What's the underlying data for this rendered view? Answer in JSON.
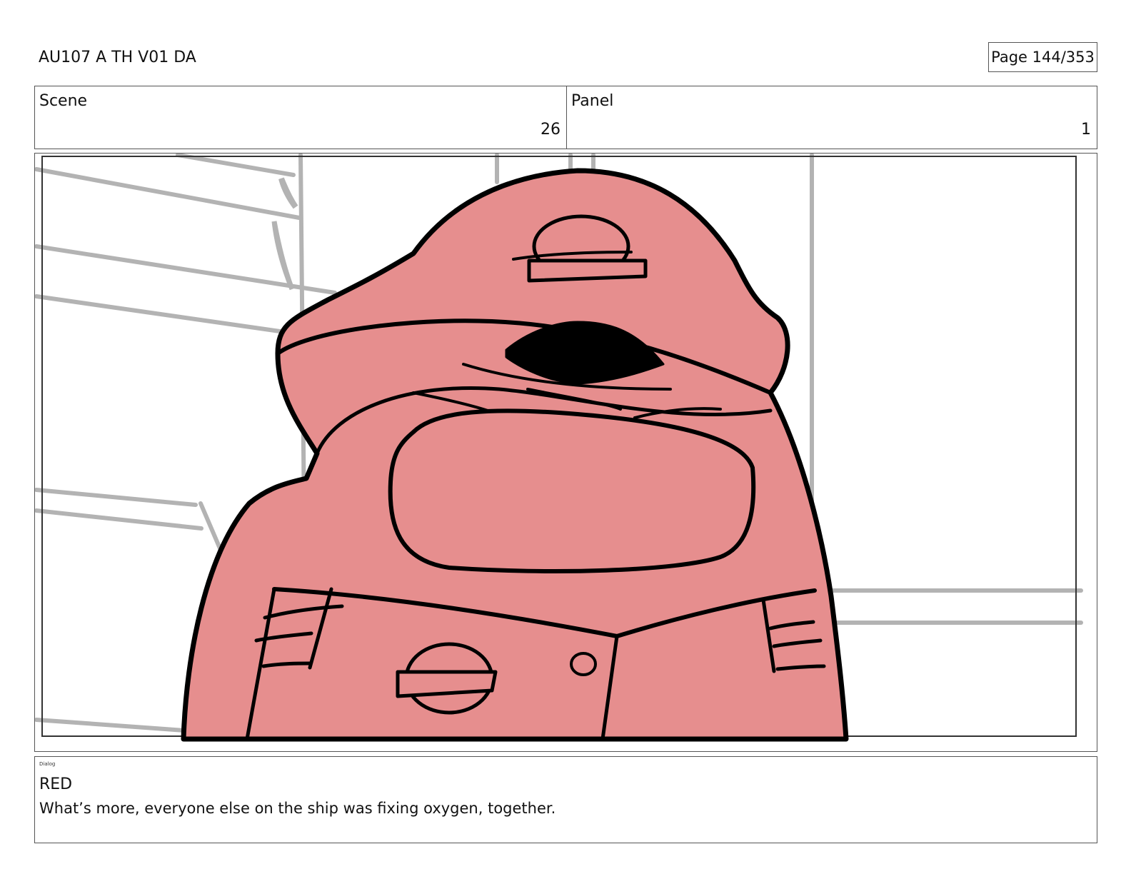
{
  "header": {
    "title": "AU107 A TH V01 DA",
    "page": "Page 144/353"
  },
  "scene": {
    "label": "Scene",
    "value": "26"
  },
  "panel": {
    "label": "Panel",
    "value": "1"
  },
  "artwork": {
    "body_color": "#e68e8e",
    "line_color": "#000000",
    "bg_sketch_color": "#b3b3b3"
  },
  "dialog": {
    "caption": "Dialog",
    "speaker": "RED",
    "line": "What’s more, everyone else on the ship was fixing oxygen, together."
  }
}
